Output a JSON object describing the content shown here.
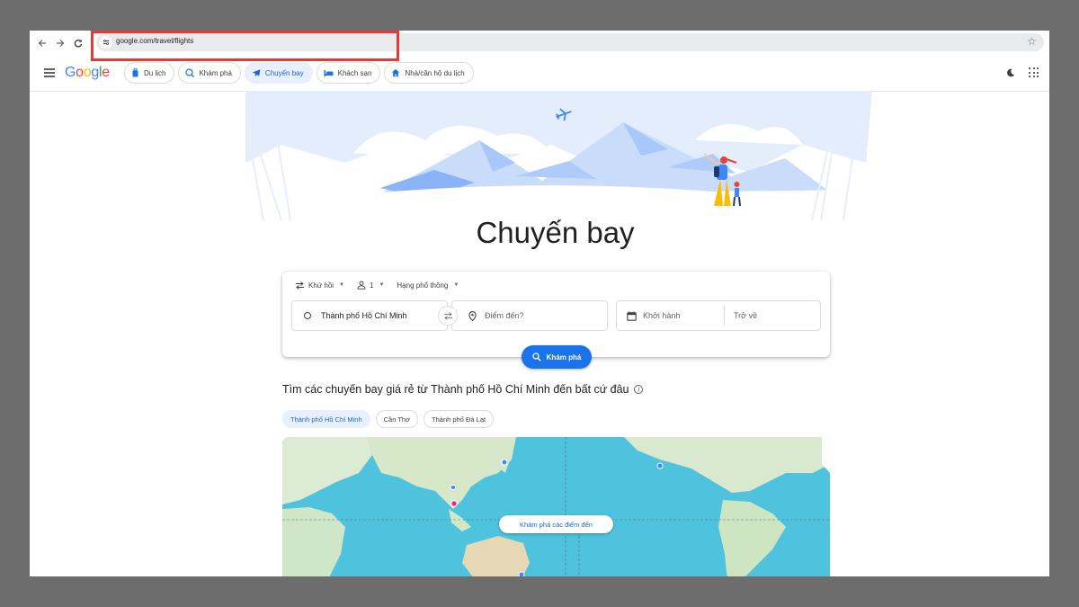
{
  "browser": {
    "url": "google.com/travel/flights",
    "back_icon": "arrow-left-icon",
    "forward_icon": "arrow-right-icon",
    "reload_icon": "reload-icon",
    "bookmark_icon": "star-icon"
  },
  "header": {
    "logo": "Google",
    "tabs": [
      {
        "label": "Du lịch",
        "icon": "suitcase-icon",
        "active": false
      },
      {
        "label": "Khám phá",
        "icon": "explore-icon",
        "active": false
      },
      {
        "label": "Chuyến bay",
        "icon": "plane-icon",
        "active": true
      },
      {
        "label": "Khách sạn",
        "icon": "bed-icon",
        "active": false
      },
      {
        "label": "Nhà/căn hộ du lịch",
        "icon": "house-icon",
        "active": false
      }
    ]
  },
  "page": {
    "title": "Chuyến bay"
  },
  "search": {
    "trip_type": "Khứ hồi",
    "passengers": "1",
    "cabin_class": "Hạng phổ thông",
    "origin": "Thành phố Hồ Chí Minh",
    "destination_placeholder": "Điểm đến?",
    "depart_placeholder": "Khởi hành",
    "return_placeholder": "Trở về",
    "explore_button": "Khám phá"
  },
  "deals": {
    "title": "Tìm các chuyến bay giá rẻ từ Thành phố Hồ Chí Minh đến bất cứ đâu",
    "cities": [
      {
        "label": "Thành phố Hồ Chí Minh",
        "active": true
      },
      {
        "label": "Cần Thơ",
        "active": false
      },
      {
        "label": "Thành phố Đà Lạt",
        "active": false
      }
    ],
    "map_button": "Khám phá các điểm đến"
  },
  "colors": {
    "accent": "#1a73e8",
    "highlight": "#e53935",
    "ocean": "#4fc3dd",
    "land": "#cfe8c8"
  }
}
